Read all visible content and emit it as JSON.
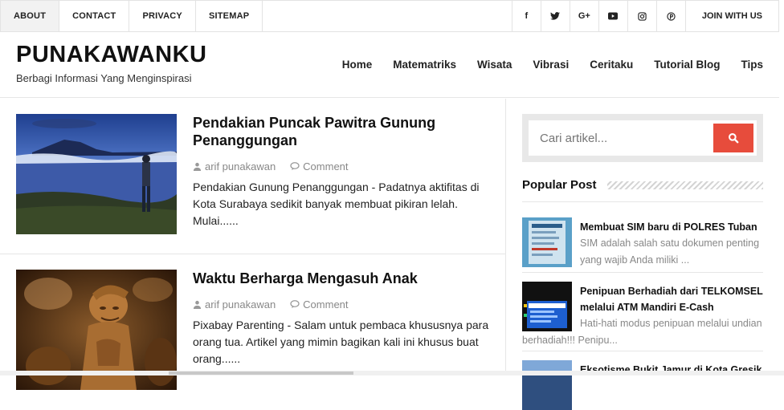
{
  "topnav": {
    "items": [
      {
        "label": "ABOUT"
      },
      {
        "label": "CONTACT"
      },
      {
        "label": "PRIVACY"
      },
      {
        "label": "SITEMAP"
      }
    ],
    "social": [
      {
        "icon": "facebook-icon",
        "glyph": "f"
      },
      {
        "icon": "twitter-icon",
        "glyph": "🐦"
      },
      {
        "icon": "google-plus-icon",
        "glyph": "G+"
      },
      {
        "icon": "youtube-icon",
        "glyph": "▶"
      },
      {
        "icon": "instagram-icon",
        "glyph": "◎"
      },
      {
        "icon": "pinterest-icon",
        "glyph": "℗"
      }
    ],
    "join_label": "JOIN WITH US"
  },
  "header": {
    "title": "PUNAKAWANKU",
    "tagline": "Berbagi Informasi Yang Menginspirasi",
    "nav": [
      "Home",
      "Matematriks",
      "Wisata",
      "Vibrasi",
      "Ceritaku",
      "Tutorial Blog",
      "Tips"
    ]
  },
  "posts": [
    {
      "title": "Pendakian Puncak Pawitra Gunung Penanggungan",
      "author": "arif punakawan",
      "comment": "Comment",
      "excerpt": "Pendakian Gunung Penanggungan - Padatnya aktifitas di Kota Surabaya sedikit banyak membuat pikiran lelah. Mulai......"
    },
    {
      "title": "Waktu Berharga Mengasuh Anak",
      "author": "arif punakawan",
      "comment": "Comment",
      "excerpt": "Pixabay Parenting - Salam untuk pembaca khususnya para orang tua. Artikel yang mimin bagikan kali ini khusus buat orang......"
    }
  ],
  "sidebar": {
    "search_placeholder": "Cari artikel...",
    "popular_title": "Popular Post",
    "popular": [
      {
        "title": "Membuat SIM baru di POLRES Tuban",
        "desc": "SIM adalah salah satu dokumen penting yang wajib Anda miliki ..."
      },
      {
        "title": "Penipuan Berhadiah dari TELKOMSEL melalui ATM Mandiri E-Cash",
        "desc": "Hati-hati modus penipuan melalui undian berhadiah!!! Penipu..."
      },
      {
        "title": "Eksotisme Bukit Jamur di Kota Gresik",
        "desc": ""
      }
    ]
  },
  "colors": {
    "accent": "#e74c3c",
    "border": "#e3e3e3"
  }
}
